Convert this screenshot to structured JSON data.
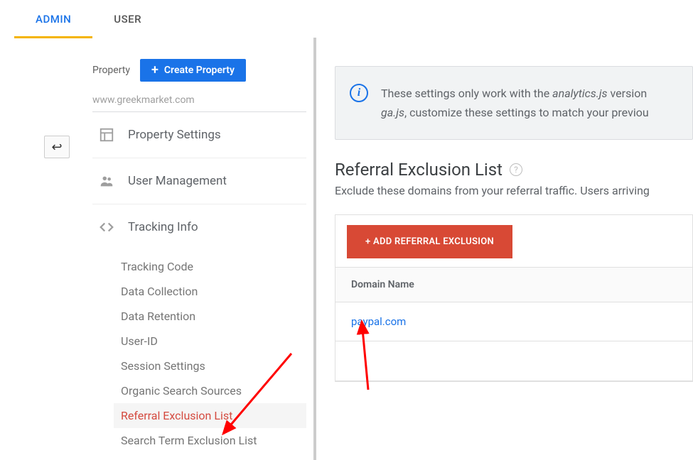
{
  "tabs": {
    "admin": "ADMIN",
    "user": "USER"
  },
  "property": {
    "label": "Property",
    "create_button": "Create Property",
    "url": "www.greekmarket.com"
  },
  "nav": {
    "property_settings": "Property Settings",
    "user_management": "User Management",
    "tracking_info": "Tracking Info",
    "tracking_sub": {
      "tracking_code": "Tracking Code",
      "data_collection": "Data Collection",
      "data_retention": "Data Retention",
      "user_id": "User-ID",
      "session_settings": "Session Settings",
      "organic_search_sources": "Organic Search Sources",
      "referral_exclusion_list": "Referral Exclusion List",
      "search_term_exclusion_list": "Search Term Exclusion List"
    }
  },
  "notice": {
    "text_prefix": "These settings only work with the ",
    "em1": "analytics.js",
    "text_mid": " version",
    "em2": "ga.js",
    "text_suffix": ", customize these settings to match your previou"
  },
  "page": {
    "title": "Referral Exclusion List",
    "description": "Exclude these domains from your referral traffic. Users arriving",
    "add_button": "+ ADD REFERRAL EXCLUSION",
    "column_header": "Domain Name",
    "rows": [
      {
        "domain": "paypal.com"
      }
    ]
  }
}
